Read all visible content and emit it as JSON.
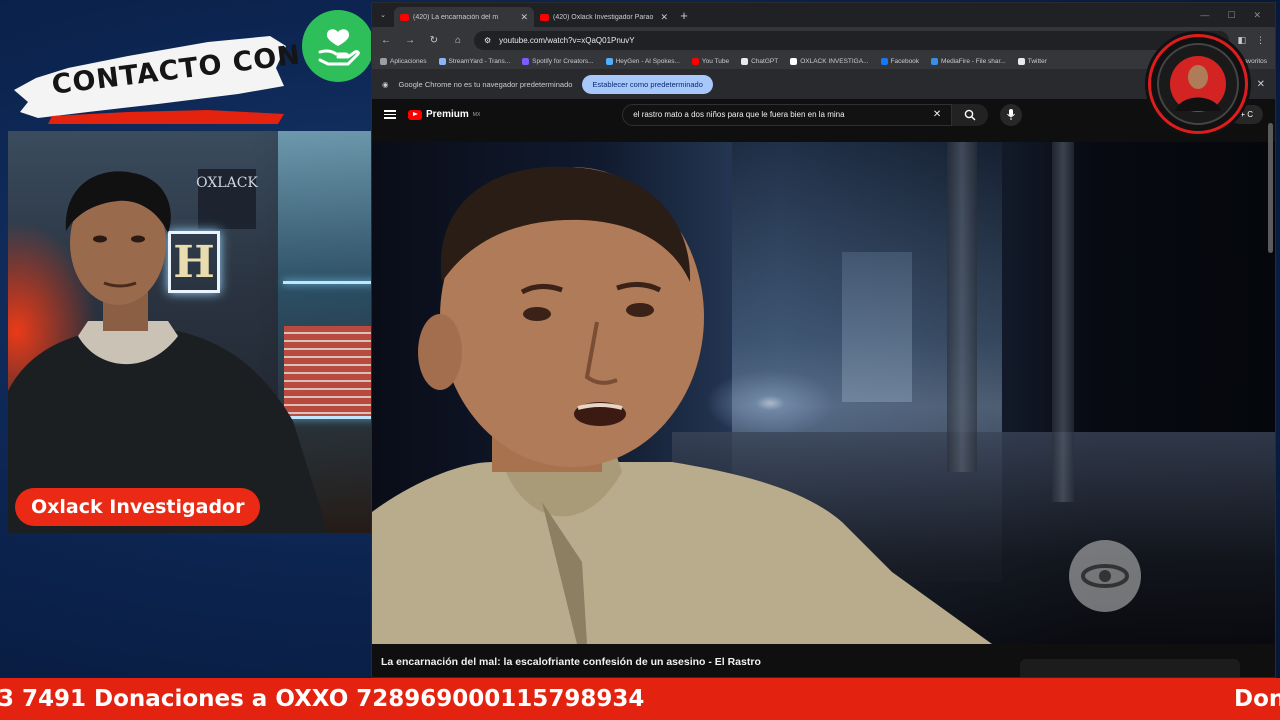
{
  "overlay": {
    "banner_text": "CONTACTO CON",
    "host_name": "Oxlack Investigador",
    "cam_sign_text": "OXLACK",
    "cam_letter": "H",
    "ticker_text": "3 7491 Donaciones a OXXO 728969000115798934",
    "ticker_next": "Don"
  },
  "browser": {
    "tabs": [
      {
        "title": "(420) La encarnación del m",
        "active": true
      },
      {
        "title": "(420) Oxlack Investigador Parao",
        "active": false
      }
    ],
    "url": "youtube.com/watch?v=xQaQ01PnuvY",
    "bookmarks": [
      "Aplicaciones",
      "StreamYard - Trans...",
      "Spotify for Creators...",
      "HeyGen - AI Spokes...",
      "You Tube",
      "ChatGPT",
      "OXLACK INVESTIGA...",
      "Facebook",
      "MediaFire - File shar...",
      "Twitter"
    ],
    "bookmarks_overflow": "avoritos",
    "infobar_text": "Google Chrome no es tu navegador predeterminado",
    "infobar_button": "Establecer como predeterminado"
  },
  "youtube": {
    "logo_text": "Premium",
    "logo_sup": "MX",
    "search_query": "el rastro mato a dos niños para que le fuera bien en la mina",
    "create_label": "+ C",
    "video_title": "La encarnación del mal: la escalofriante confesión de un asesino - El Rastro"
  },
  "colors": {
    "ticker_bg": "#e3220f",
    "host_pill_bg": "#ea2a14",
    "donate_badge_bg": "#2fbf5a",
    "yt_red": "#ff0000",
    "infobar_button_bg": "#a8c7fa"
  },
  "icons": {
    "donate": "hand-heart-icon",
    "channel": "channel-avatar-icon",
    "player_watermark": "caracol-logo-icon"
  }
}
